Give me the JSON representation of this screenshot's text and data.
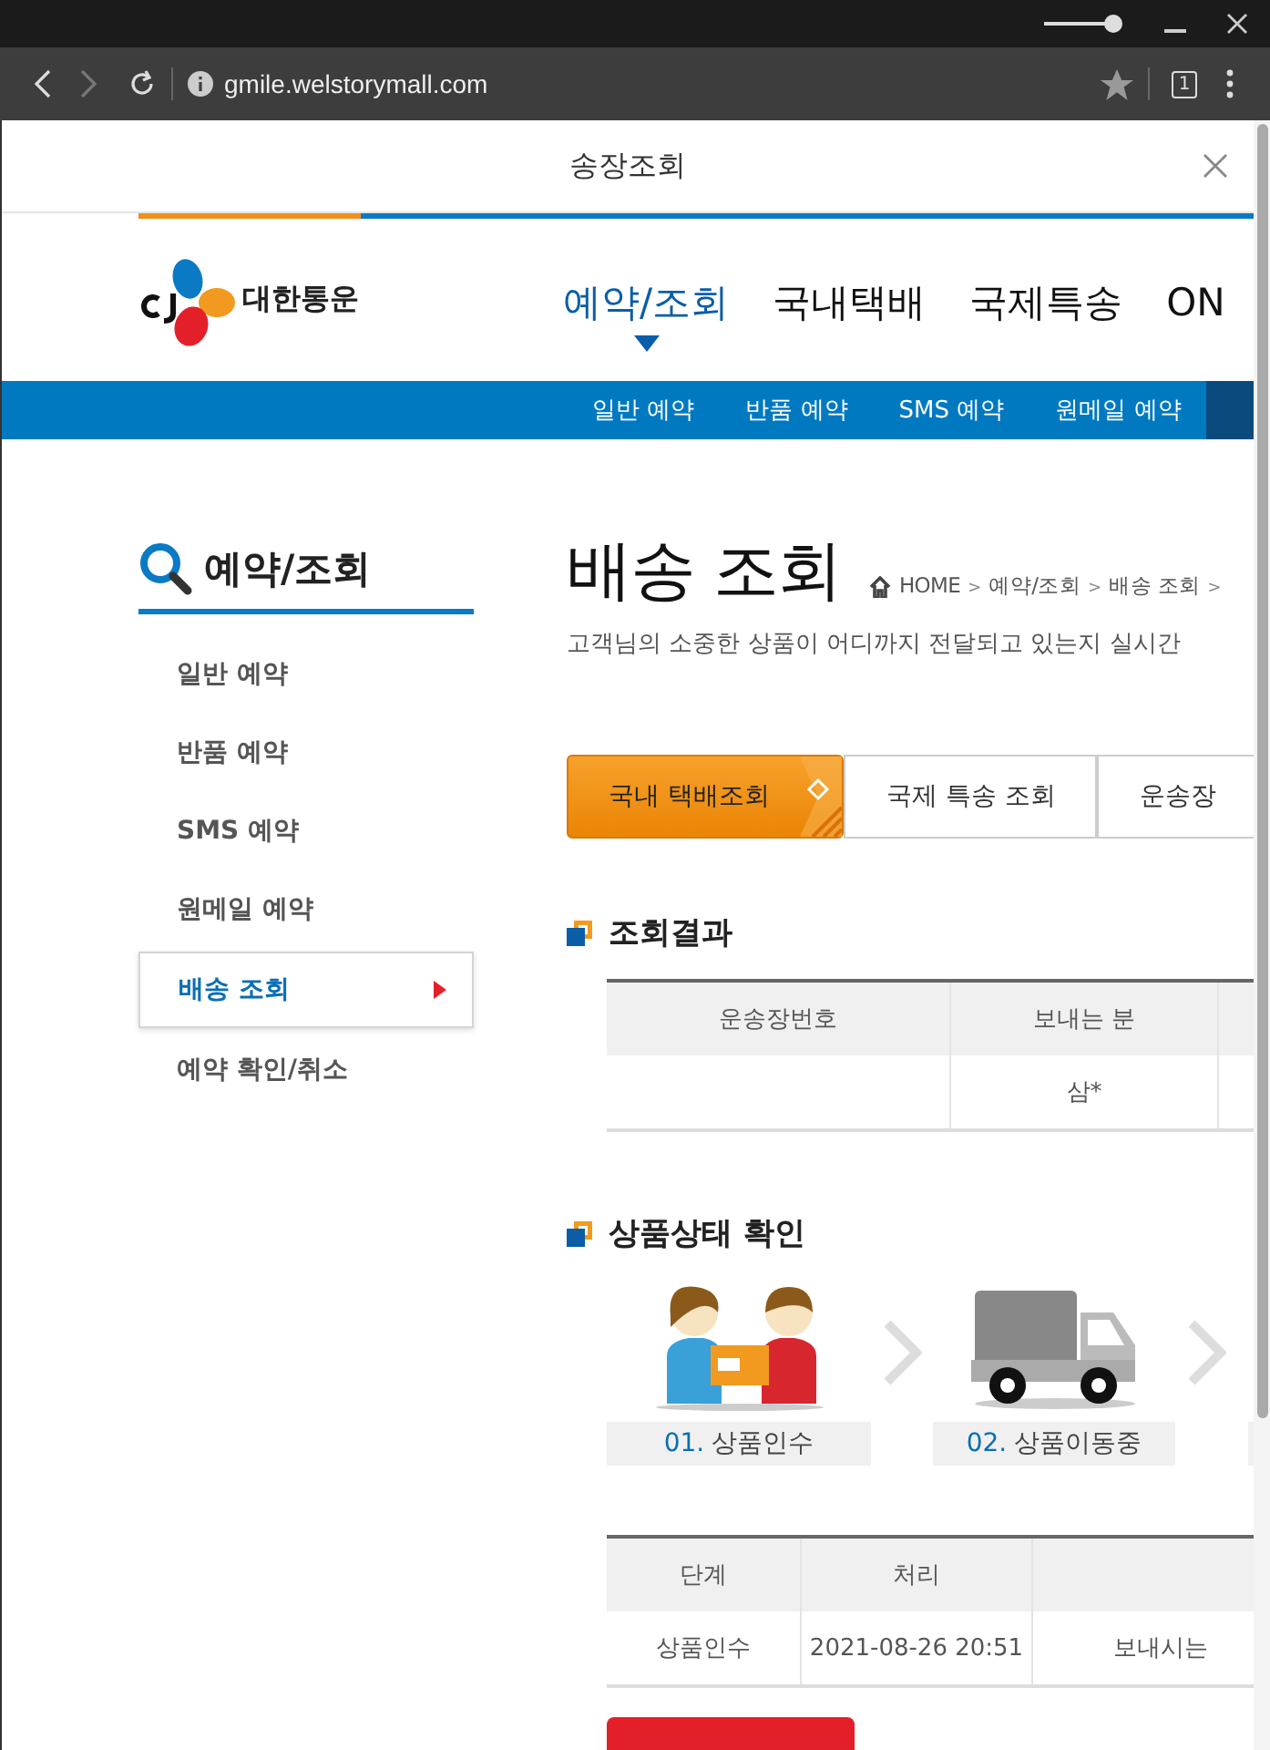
{
  "browser": {
    "url": "gmile.welstorymall.com",
    "tab_count": "1"
  },
  "popup": {
    "title": "송장조회"
  },
  "header": {
    "logo_text": "대한통운",
    "nav": [
      {
        "label": "예약/조회",
        "selected": true
      },
      {
        "label": "국내택배",
        "selected": false
      },
      {
        "label": "국제특송",
        "selected": false
      },
      {
        "label": "ON",
        "selected": false
      }
    ]
  },
  "subnav": [
    {
      "label": "일반 예약",
      "selected": false
    },
    {
      "label": "반품 예약",
      "selected": false
    },
    {
      "label": "SMS 예약",
      "selected": false
    },
    {
      "label": "원메일 예약",
      "selected": false
    }
  ],
  "sidebar": {
    "title": "예약/조회",
    "items": [
      {
        "label": "일반 예약",
        "selected": false
      },
      {
        "label": "반품 예약",
        "selected": false
      },
      {
        "label": "SMS 예약",
        "selected": false
      },
      {
        "label": "원메일 예약",
        "selected": false
      },
      {
        "label": "배송 조회",
        "selected": true
      },
      {
        "label": "예약 확인/취소",
        "selected": false
      }
    ]
  },
  "page": {
    "title": "배송 조회",
    "breadcrumb": [
      {
        "text": "HOME",
        "kind": "link"
      },
      {
        "text": ">",
        "kind": "separator"
      },
      {
        "text": "예약/조회",
        "kind": "link"
      },
      {
        "text": ">",
        "kind": "separator"
      },
      {
        "text": "배송 조회",
        "kind": "link"
      },
      {
        "text": ">",
        "kind": "separator"
      }
    ],
    "description": "고객님의 소중한 상품이 어디까지 전달되고 있는지 실시간"
  },
  "tabs": [
    {
      "label": "국내 택배조회",
      "selected": true
    },
    {
      "label": "국제 특송 조회",
      "selected": false
    },
    {
      "label": "운송장",
      "selected": false
    }
  ],
  "results": {
    "title": "조회결과",
    "columns": [
      "운송장번호",
      "보내는 분"
    ],
    "rows": [
      [
        "",
        "삼*"
      ]
    ]
  },
  "status": {
    "title": "상품상태 확인",
    "steps": [
      {
        "number": "01.",
        "label": "상품인수",
        "kind": "handover"
      },
      {
        "number": "02.",
        "label": "상품이동중",
        "kind": "truck"
      }
    ],
    "columns": [
      "단계",
      "처리"
    ],
    "rows": [
      [
        "상품인수",
        "2021-08-26 20:51",
        "보내시는"
      ]
    ]
  }
}
